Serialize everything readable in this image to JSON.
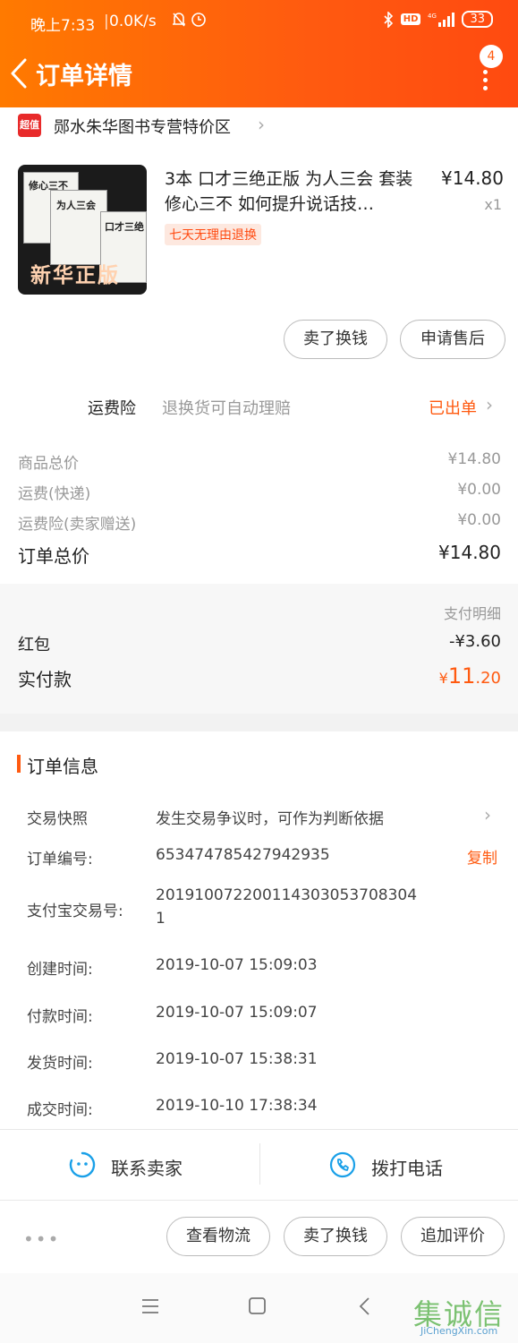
{
  "status_bar": {
    "time": "晚上7:33",
    "speed": "0.0K/s",
    "battery": "33",
    "network": "4G",
    "hd": "HD"
  },
  "header": {
    "title": "订单详情",
    "notification_count": "4"
  },
  "shop": {
    "logo_text": "超值",
    "name": "郧水朱华图书专营特价区"
  },
  "product": {
    "title": "3本 口才三绝正版 为人三会 套装修心三不 如何提升说话技…",
    "return_policy": "七天无理由退换",
    "price": "¥14.80",
    "quantity": "x1",
    "image_texts": {
      "book1": "修心三不",
      "book2": "为人三会",
      "book3": "口才三绝",
      "banner": "新华正版"
    }
  },
  "product_actions": {
    "sell": "卖了换钱",
    "after_sale": "申请售后"
  },
  "insurance": {
    "label": "运费险",
    "desc": "退换货可自动理赔",
    "status": "已出单"
  },
  "price_breakdown": {
    "rows": [
      {
        "label": "商品总价",
        "value": "¥14.80"
      },
      {
        "label": "运费(快递)",
        "value": "¥0.00"
      },
      {
        "label": "运费险(卖家赠送)",
        "value": "¥0.00"
      }
    ],
    "total_label": "订单总价",
    "total_value": "¥14.80"
  },
  "payment": {
    "detail_label": "支付明细",
    "hongbao_label": "红包",
    "hongbao_value": "-¥3.60",
    "paid_label": "实付款",
    "paid_symbol": "¥",
    "paid_int": "11",
    "paid_dec": ".20"
  },
  "order_info": {
    "title": "订单信息",
    "snapshot_label": "交易快照",
    "snapshot_value": "发生交易争议时，可作为判断依据",
    "order_no_label": "订单编号:",
    "order_no": "653474785427942935",
    "copy_label": "复制",
    "alipay_label": "支付宝交易号:",
    "alipay_no_line1": "201910072200114303053708304",
    "alipay_no_line2": "1",
    "created_label": "创建时间:",
    "created": "2019-10-07 15:09:03",
    "paid_time_label": "付款时间:",
    "paid_time": "2019-10-07 15:09:07",
    "shipped_label": "发货时间:",
    "shipped": "2019-10-07 15:38:31",
    "completed_label": "成交时间:",
    "completed": "2019-10-10 17:38:34"
  },
  "contact": {
    "seller": "联系卖家",
    "phone": "拨打电话"
  },
  "bottom_actions": {
    "more": "•••",
    "logistics": "查看物流",
    "sell": "卖了换钱",
    "review": "追加评价"
  },
  "watermark": {
    "mark": "集诚信",
    "url": "JiChengXin.com"
  },
  "colors": {
    "accent": "#ff5a10",
    "header_start": "#ff7a00",
    "header_end": "#ff4a10"
  }
}
